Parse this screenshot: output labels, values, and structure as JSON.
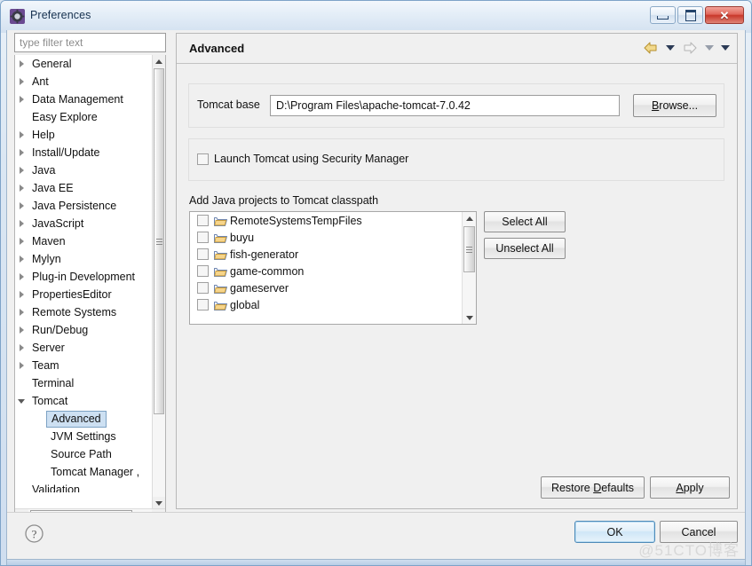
{
  "window": {
    "title": "Preferences",
    "icon": "preferences-gear-icon",
    "controls": {
      "minimize": "minimize",
      "maximize": "restore",
      "close": "close"
    }
  },
  "filter": {
    "placeholder": "type filter text",
    "value": ""
  },
  "tree": {
    "items": [
      {
        "label": "General",
        "level": 0,
        "twisty": "closed"
      },
      {
        "label": "Ant",
        "level": 0,
        "twisty": "closed"
      },
      {
        "label": "Data Management",
        "level": 0,
        "twisty": "closed"
      },
      {
        "label": "Easy Explore",
        "level": 0,
        "twisty": "none"
      },
      {
        "label": "Help",
        "level": 0,
        "twisty": "closed"
      },
      {
        "label": "Install/Update",
        "level": 0,
        "twisty": "closed"
      },
      {
        "label": "Java",
        "level": 0,
        "twisty": "closed"
      },
      {
        "label": "Java EE",
        "level": 0,
        "twisty": "closed"
      },
      {
        "label": "Java Persistence",
        "level": 0,
        "twisty": "closed"
      },
      {
        "label": "JavaScript",
        "level": 0,
        "twisty": "closed"
      },
      {
        "label": "Maven",
        "level": 0,
        "twisty": "closed"
      },
      {
        "label": "Mylyn",
        "level": 0,
        "twisty": "closed"
      },
      {
        "label": "Plug-in Development",
        "level": 0,
        "twisty": "closed"
      },
      {
        "label": "PropertiesEditor",
        "level": 0,
        "twisty": "closed"
      },
      {
        "label": "Remote Systems",
        "level": 0,
        "twisty": "closed"
      },
      {
        "label": "Run/Debug",
        "level": 0,
        "twisty": "closed"
      },
      {
        "label": "Server",
        "level": 0,
        "twisty": "closed"
      },
      {
        "label": "Team",
        "level": 0,
        "twisty": "closed"
      },
      {
        "label": "Terminal",
        "level": 0,
        "twisty": "none"
      },
      {
        "label": "Tomcat",
        "level": 0,
        "twisty": "open"
      },
      {
        "label": "Advanced",
        "level": 1,
        "twisty": "none",
        "selected": true
      },
      {
        "label": "JVM Settings",
        "level": 1,
        "twisty": "none"
      },
      {
        "label": "Source Path",
        "level": 1,
        "twisty": "none"
      },
      {
        "label": "Tomcat Manager ,",
        "level": 1,
        "twisty": "none"
      },
      {
        "label": "Validation",
        "level": 0,
        "twisty": "none",
        "clipped": true
      }
    ]
  },
  "page": {
    "title": "Advanced",
    "nav": {
      "back_icon": "back-arrow-icon",
      "back_menu_icon": "chevron-down-icon",
      "forward_icon": "forward-arrow-icon",
      "forward_menu_icon": "chevron-down-icon",
      "menu_icon": "chevron-down-icon"
    },
    "tomcat_base": {
      "label": "Tomcat base",
      "value": "D:\\Program Files\\apache-tomcat-7.0.42",
      "placeholder": "",
      "browse_label": "Browse...",
      "browse_mnemonic": "B"
    },
    "security_manager": {
      "label": "Launch Tomcat using Security Manager",
      "checked": false
    },
    "classpath": {
      "label": "Add Java projects to Tomcat classpath",
      "projects": [
        {
          "name": "RemoteSystemsTempFiles",
          "checked": false
        },
        {
          "name": "buyu",
          "checked": false
        },
        {
          "name": "fish-generator",
          "checked": false
        },
        {
          "name": "game-common",
          "checked": false
        },
        {
          "name": "gameserver",
          "checked": false
        },
        {
          "name": "global",
          "checked": false
        }
      ],
      "select_all_label": "Select All",
      "unselect_all_label": "Unselect All"
    },
    "restore_defaults_label": "Restore Defaults",
    "restore_defaults_mnemonic": "D",
    "apply_label": "Apply",
    "apply_mnemonic": "A"
  },
  "footer": {
    "help_icon": "help-question-icon",
    "ok_label": "OK",
    "cancel_label": "Cancel",
    "watermark": "@51CTO博客"
  },
  "colors": {
    "accent": "#4e8ab8",
    "selection": "#cde0f2",
    "close_red": "#c8372a",
    "folder": "#f0c05a",
    "dialog_bg": "#f0f0f0"
  }
}
